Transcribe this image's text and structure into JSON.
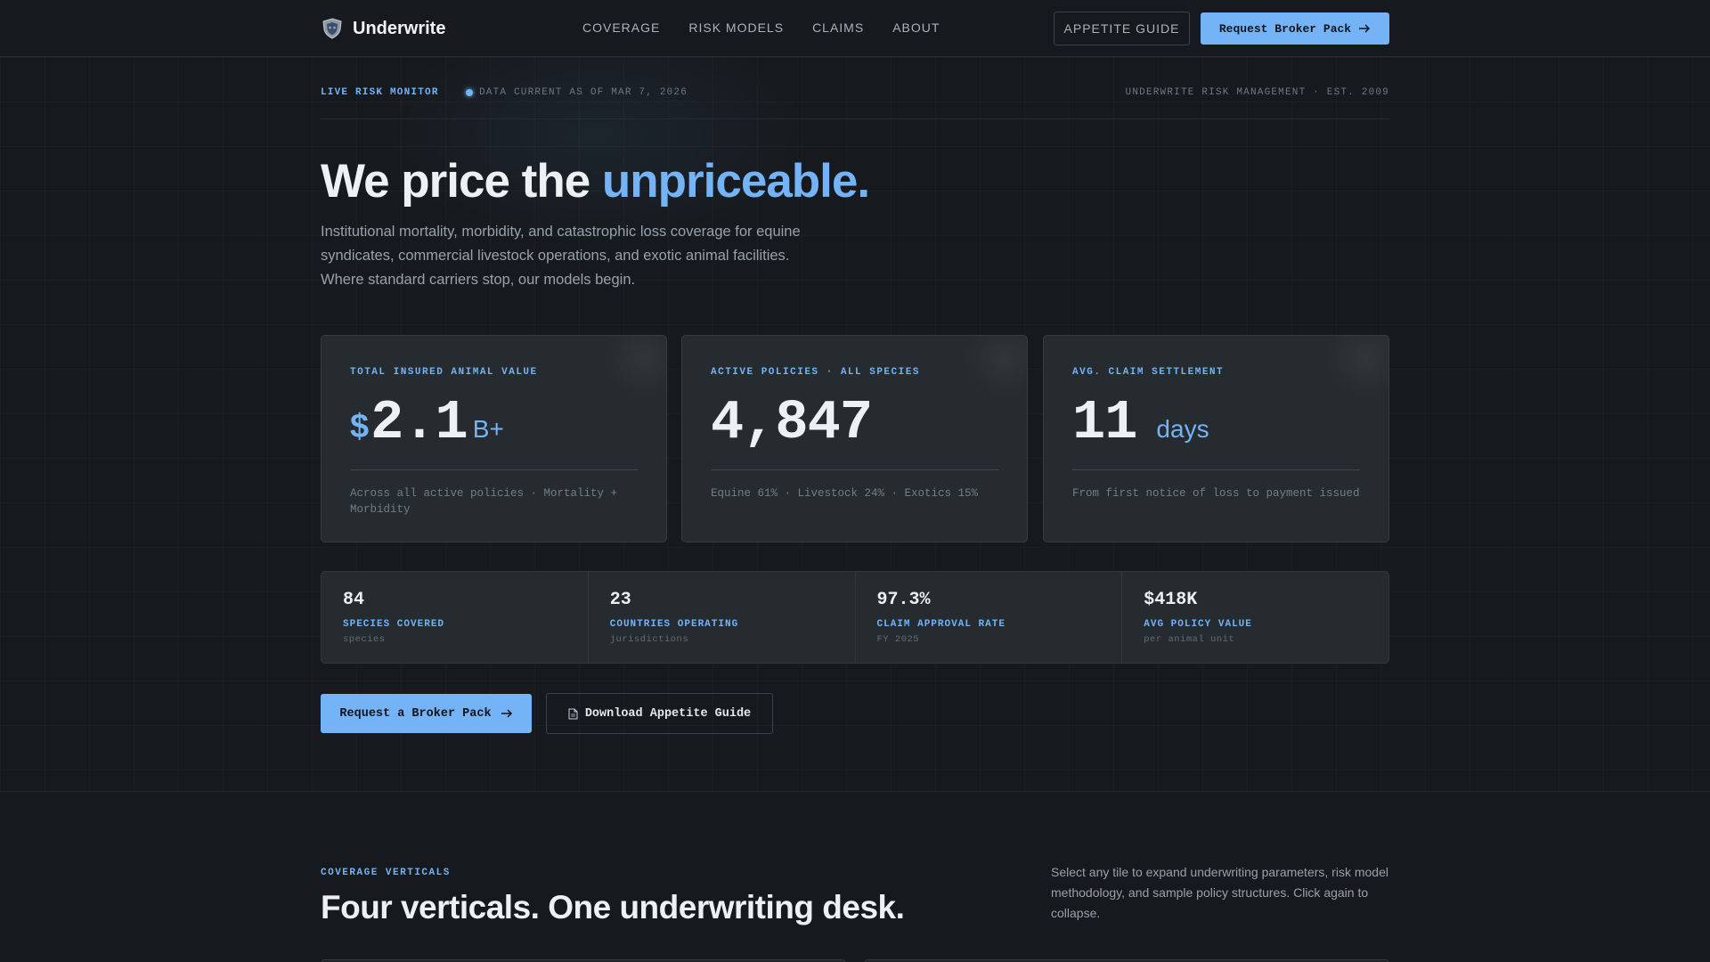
{
  "nav": {
    "brand": "Underwrite",
    "links": [
      "COVERAGE",
      "RISK MODELS",
      "CLAIMS",
      "ABOUT"
    ],
    "appetite_button": "APPETITE GUIDE",
    "broker_button": "Request Broker Pack"
  },
  "status": {
    "live_label": "LIVE RISK MONITOR",
    "data_current": "DATA CURRENT AS OF MAR 7, 2026",
    "company": "UNDERWRITE RISK MANAGEMENT · EST. 2009"
  },
  "hero": {
    "title_plain": "We price the ",
    "title_accent": "unpriceable.",
    "description": "Institutional mortality, morbidity, and catastrophic loss coverage for equine syndicates, commercial livestock operations, and exotic animal facilities. Where standard carriers stop, our models begin."
  },
  "cards": [
    {
      "label": "TOTAL INSURED ANIMAL VALUE",
      "prefix": "$",
      "number": "2.1",
      "suffix": "B+",
      "note": "Across all active policies · Mortality + Morbidity"
    },
    {
      "label": "ACTIVE POLICIES · ALL SPECIES",
      "prefix": "",
      "number": "4,847",
      "suffix": "",
      "note": "Equine 61% · Livestock 24% · Exotics 15%"
    },
    {
      "label": "AVG. CLAIM SETTLEMENT",
      "prefix": "",
      "number": "11",
      "suffix": "days",
      "note": "From first notice of loss to payment issued"
    }
  ],
  "stats": [
    {
      "value": "84",
      "label": "SPECIES COVERED",
      "sub": "species"
    },
    {
      "value": "23",
      "label": "COUNTRIES OPERATING",
      "sub": "jurisdictions"
    },
    {
      "value": "97.3%",
      "label": "CLAIM APPROVAL RATE",
      "sub": "FY 2025"
    },
    {
      "value": "$418K",
      "label": "AVG POLICY VALUE",
      "sub": "per animal unit"
    }
  ],
  "cta": {
    "primary": "Request a Broker Pack",
    "secondary": "Download Appetite Guide"
  },
  "coverage": {
    "eyebrow": "COVERAGE VERTICALS",
    "title": "Four verticals. One underwriting desk.",
    "description": "Select any tile to expand underwriting parameters, risk model methodology, and sample policy structures. Click again to collapse."
  },
  "colors": {
    "accent": "#74b3f5",
    "background": "#161a1e",
    "card": "#262b30"
  },
  "icons": {
    "brand": "shield-icon",
    "arrow": "arrow-right-icon",
    "document": "document-icon",
    "live": "live-dot-icon"
  }
}
